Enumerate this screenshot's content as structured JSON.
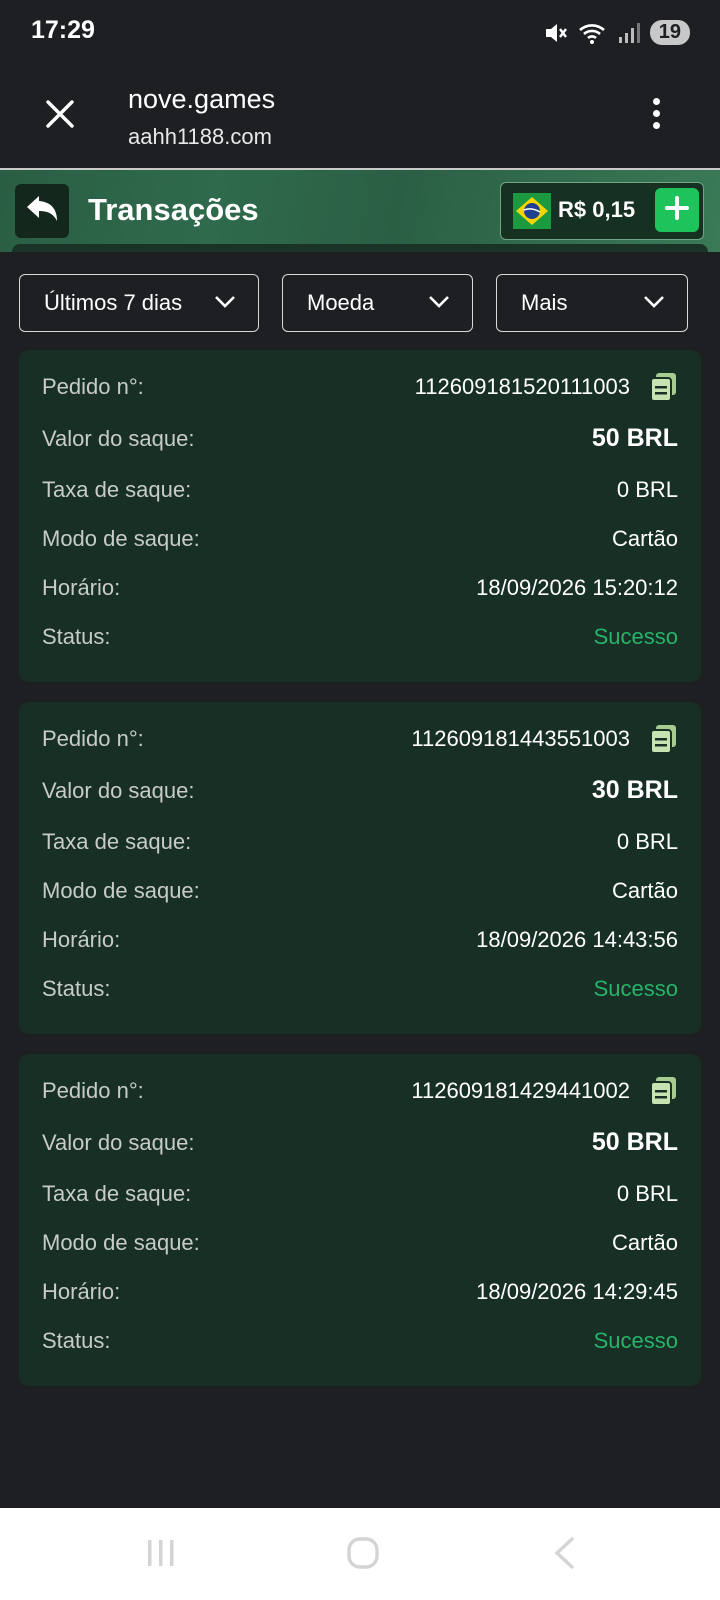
{
  "status_bar": {
    "time": "17:29",
    "battery": "19",
    "icons": [
      "mute-icon",
      "wifi-icon",
      "signal-icon"
    ]
  },
  "browser": {
    "title": "nove.games",
    "url": "aahh1188.com",
    "icons": [
      "close-icon",
      "more-vertical-icon"
    ]
  },
  "header": {
    "title": "Transações",
    "balance": "R$ 0,15",
    "icons": [
      "back-arrow-icon",
      "brazil-flag-icon",
      "plus-icon"
    ]
  },
  "filters": [
    {
      "label": "Últimos 7 dias"
    },
    {
      "label": "Moeda"
    },
    {
      "label": "Mais"
    }
  ],
  "labels": {
    "order": "Pedido n°:",
    "amount": "Valor do saque:",
    "fee": "Taxa de saque:",
    "mode": "Modo de saque:",
    "time": "Horário:",
    "status": "Status:"
  },
  "transactions": [
    {
      "order_no": "112609181520111003",
      "amount": "50 BRL",
      "fee": "0 BRL",
      "mode": "Cartão",
      "time": "18/09/2026 15:20:12",
      "status": "Sucesso"
    },
    {
      "order_no": "112609181443551003",
      "amount": "30 BRL",
      "fee": "0 BRL",
      "mode": "Cartão",
      "time": "18/09/2026 14:43:56",
      "status": "Sucesso"
    },
    {
      "order_no": "112609181429441002",
      "amount": "50 BRL",
      "fee": "0 BRL",
      "mode": "Cartão",
      "time": "18/09/2026 14:29:45",
      "status": "Sucesso"
    }
  ],
  "colors": {
    "background": "#1d1f23",
    "card": "#172f24",
    "header": "#2f6a4c",
    "success": "#27b36a",
    "accent_button": "#1fc35b"
  }
}
